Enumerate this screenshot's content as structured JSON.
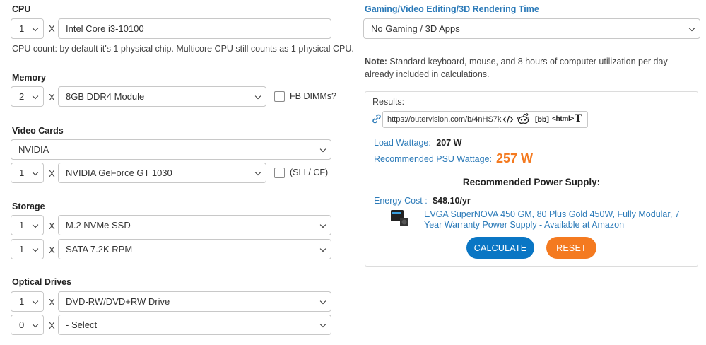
{
  "cpu": {
    "label": "CPU",
    "qty": "1",
    "x": "X",
    "model": "Intel Core i3-10100",
    "note": "CPU count: by default it's 1 physical chip. Multicore CPU still counts as 1 physical CPU."
  },
  "memory": {
    "label": "Memory",
    "qty": "2",
    "x": "X",
    "module": "8GB DDR4 Module",
    "fb_dimms_label": "FB DIMMs?"
  },
  "video": {
    "label": "Video Cards",
    "brand": "NVIDIA",
    "qty": "1",
    "x": "X",
    "model": "NVIDIA GeForce GT 1030",
    "sli_label": "(SLI / CF)"
  },
  "storage": {
    "label": "Storage",
    "items": [
      {
        "qty": "1",
        "x": "X",
        "type": "M.2 NVMe SSD"
      },
      {
        "qty": "1",
        "x": "X",
        "type": "SATA 7.2K RPM"
      }
    ]
  },
  "optical": {
    "label": "Optical Drives",
    "items": [
      {
        "qty": "1",
        "x": "X",
        "type": "DVD-RW/DVD+RW Drive"
      },
      {
        "qty": "0",
        "x": "X",
        "type": "- Select"
      }
    ]
  },
  "gaming": {
    "label": "Gaming/Video Editing/3D Rendering Time",
    "value": "No Gaming / 3D Apps"
  },
  "note": {
    "bold": "Note:",
    "text": " Standard keyboard, mouse, and 8 hours of computer utilization per day already included in calculations."
  },
  "results": {
    "label": "Results:",
    "url": "https://outervision.com/b/4nHS7k",
    "bb": "[bb]",
    "html": "<html>",
    "t": "T",
    "load_label": "Load Wattage:",
    "load_value": "207 W",
    "psu_label": "Recommended PSU Wattage:",
    "psu_value": "257 W",
    "rec_title": "Recommended Power Supply:",
    "energy_label": "Energy Cost :",
    "energy_value": "$48.10/yr",
    "product": "EVGA SuperNOVA 450 GM, 80 Plus Gold 450W, Fully Modular, 7 Year Warranty Power Supply - Available at Amazon",
    "calculate": "CALCULATE",
    "reset": "RESET"
  },
  "colors": {
    "link": "#2b7ab8",
    "psu_value": "#f47a20",
    "calculate": "#0a76c4",
    "reset": "#f47a20"
  }
}
